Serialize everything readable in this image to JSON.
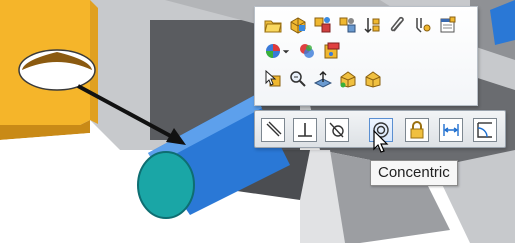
{
  "viewport": {
    "colors": {
      "plate": "#f5b52a",
      "plate_dark": "#c98a17",
      "dark_part": "#5a5c60",
      "gray_part": "#9c9ea2",
      "light_gray": "#c7c9cc",
      "shaft": "#2a78d6",
      "shaft_end": "#1aa6a6",
      "accent": "#1f6fcf"
    }
  },
  "context_toolbar": {
    "rows": [
      [
        "open-part-icon",
        "edit-component-icon",
        "component-properties-icon",
        "isolate-icon",
        "sort-icon",
        "clip-icon",
        "sensor-icon",
        "document-properties-icon"
      ],
      [
        "appearance-icon",
        "change-transparency-icon",
        "material-icon"
      ],
      [
        "select-other-icon",
        "zoom-to-selection-icon",
        "normal-to-icon",
        "view-part-icon",
        "hide-show-icon"
      ]
    ]
  },
  "mate_popup": {
    "buttons": [
      {
        "name": "coincident-icon"
      },
      {
        "name": "perpendicular-icon"
      },
      {
        "name": "tangent-icon"
      },
      {
        "name": "concentric-icon",
        "active": true
      },
      {
        "name": "lock-icon"
      },
      {
        "name": "distance-icon"
      },
      {
        "name": "angle-icon"
      }
    ]
  },
  "tooltip": {
    "text": "Concentric"
  }
}
